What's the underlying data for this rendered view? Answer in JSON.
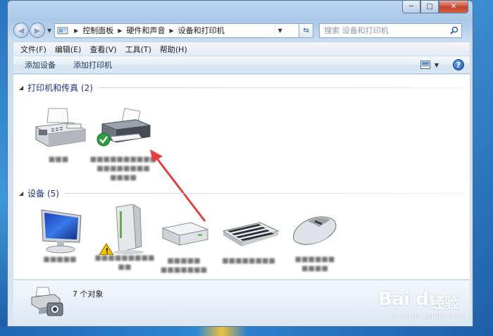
{
  "window": {
    "caption": {
      "minimize": "─",
      "maximize": "□",
      "close": "✕"
    }
  },
  "nav": {
    "back_icon": "back-arrow-icon",
    "forward_icon": "forward-arrow-icon",
    "breadcrumbs": [
      "控制面板",
      "硬件和声音",
      "设备和打印机"
    ],
    "search_placeholder": "搜索 设备和打印机"
  },
  "menu": [
    "文件(F)",
    "编辑(E)",
    "查看(V)",
    "工具(T)",
    "帮助(H)"
  ],
  "commands": {
    "add_device": "添加设备",
    "add_printer": "添加打印机",
    "help": "?"
  },
  "groups": [
    {
      "title": "打印机和传真 (2)"
    },
    {
      "title": "设备 (5)"
    }
  ],
  "details": {
    "count_text": "7 个对象"
  },
  "watermark": {
    "logo": "Bai du",
    "text": "经验",
    "url": "jingyan.baidu.com"
  },
  "colors": {
    "group_title": "#1e3287",
    "accent_arrow": "#e04040",
    "default_check": "#2ea043"
  }
}
